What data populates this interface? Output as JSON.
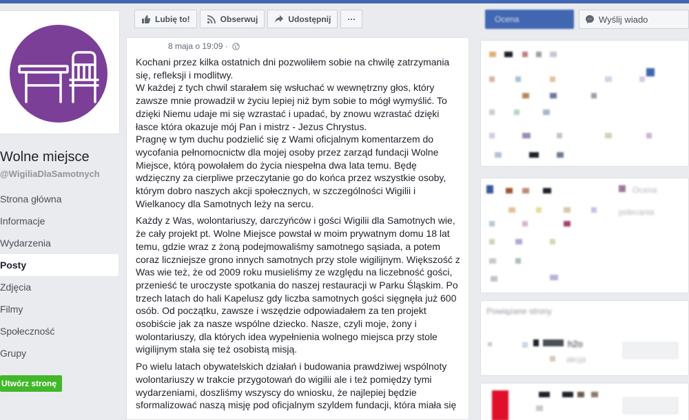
{
  "page": {
    "name": "Wolne miejsce",
    "handle": "@WigiliaDlaSamotnych"
  },
  "nav": {
    "items": [
      {
        "label": "Strona główna",
        "active": false
      },
      {
        "label": "Informacje",
        "active": false
      },
      {
        "label": "Wydarzenia",
        "active": false
      },
      {
        "label": "Posty",
        "active": true
      },
      {
        "label": "Zdjęcia",
        "active": false
      },
      {
        "label": "Filmy",
        "active": false
      },
      {
        "label": "Społeczność",
        "active": false
      },
      {
        "label": "Grupy",
        "active": false
      }
    ],
    "create_page": "Utwórz stronę"
  },
  "actions": {
    "like": "Lubię to!",
    "follow": "Obserwuj",
    "share": "Udostępnij",
    "more": "···",
    "message": "Wyślij wiado"
  },
  "post": {
    "timestamp": "8 maja o 19:09 ·",
    "paragraphs": [
      "Kochani przez kilka ostatnich dni pozwoliłem sobie na chwilę zatrzymania się, refleksji i modlitwy.\nW każdej z tych chwil starałem się wsłuchać w wewnętrzny głos, który zawsze mnie prowadził w życiu lepiej niż bym sobie to mógł wymyślić. To dzięki Niemu udaje mi się wzrastać i upadać, by znowu wzrastać dzięki łasce która okazuje mój Pan i mistrz - Jezus Chrystus.\nPragnę w tym duchu podzielić się z Wami oficjalnym komentarzem do wycofania pełnomocnictw dla mojej osoby przez zarząd fundacji Wolne Miejsce, którą powołałem do życia niespełna dwa lata temu. Będę wdzięczny za cierpliwe przeczytanie go do końca przez wszystkie osoby, którym dobro naszych akcji społecznych, w szczególności Wigilii i Wielkanocy dla Samotnych leży na sercu.",
      "Każdy z Was, wolontariuszy, darczyńców i gości Wigilii dla Samotnych wie, że cały projekt pt. Wolne Miejsce powstał w moim prywatnym domu 18 lat temu, gdzie wraz z żoną podejmowaliśmy samotnego sąsiada, a potem coraz liczniejsze grono innych samotnych przy stole wigilijnym. Większość z Was wie też, że od 2009 roku musieliśmy ze względu na liczebność gości, przenieść te uroczyste spotkania do naszej restauracji w Parku Śląskim. Po trzech latach do hali Kapelusz gdy liczba samotnych gości sięgnęła już 600 osób. Od początku, zawsze i wszędzie odpowiadałem za ten projekt osobiście jak za nasze wspólne dziecko. Nasze, czyli moje, żony i wolontariuszy, dla których idea wypełnienia wolnego miejsca przy stole wigilijnym stała się też osobistą misją.",
      "Po wielu latach obywatelskich działań i budowania prawdziwej wspólnoty wolontariuszy w trakcie przygotowań do wigilii ale i też pomiędzy tymi wydarzeniami, doszliśmy wszyscy do wniosku, że najlepiej będzie sformalizować naszą misję pod oficjalnym szyldem fundacji, która miała się"
    ]
  },
  "sidebar_right": {
    "blurred_label_1": "Ocena",
    "blurred_label_2": "polecania",
    "blurred_label_3": "Powiązane strony",
    "blurred_name": "h2o",
    "blurred_caption": "akcja"
  },
  "colors": {
    "brand_blue": "#4267b2",
    "avatar_purple": "#7b3f98",
    "create_green": "#42b72a"
  }
}
